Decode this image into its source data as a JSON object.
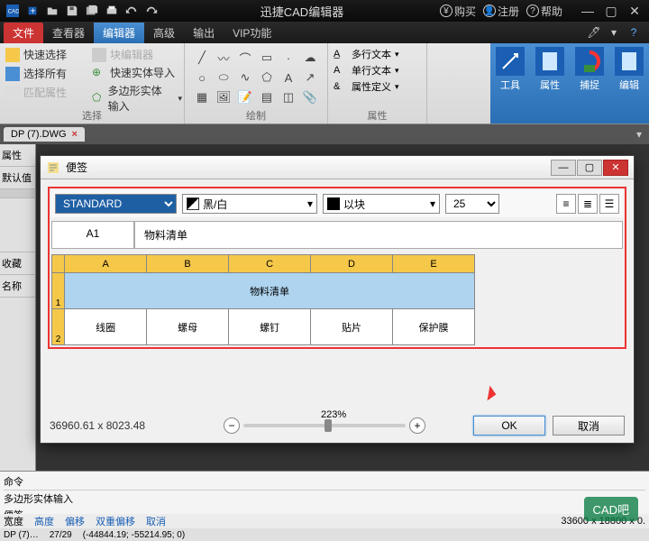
{
  "titlebar": {
    "title": "迅捷CAD编辑器",
    "buy": "购买",
    "register": "注册",
    "help": "帮助"
  },
  "menu": {
    "file": "文件",
    "viewer": "查看器",
    "editor": "编辑器",
    "advanced": "高级",
    "output": "输出",
    "vip": "VIP功能"
  },
  "ribbon": {
    "quick_select": "快速选择",
    "block_editor": "块编辑器",
    "select_all": "选择所有",
    "quick_entity_import": "快速实体导入",
    "match_props": "匹配属性",
    "poly_entity_input": "多边形实体输入",
    "group_select": "选择",
    "group_draw": "绘制",
    "multiline_text": "多行文本",
    "singleline_text": "单行文本",
    "attr_def": "属性定义",
    "group_attr": "属性",
    "tools": "工具",
    "properties": "属性",
    "capture": "捕捉",
    "edit": "编辑"
  },
  "doc_tab": "DP (7).DWG",
  "left_tabs": {
    "props": "属性",
    "defaults": "默认值",
    "favorites": "收藏",
    "name": "名称"
  },
  "dialog": {
    "title": "便签",
    "style": "STANDARD",
    "color_option": "黑/白",
    "layer_option": "以块",
    "size": "25",
    "cell_ref": "A1",
    "cell_formula": "物料清单",
    "cols": [
      "A",
      "B",
      "C",
      "D",
      "E"
    ],
    "rows": [
      {
        "num": "1",
        "merged": true,
        "value": "物料清单"
      },
      {
        "num": "2",
        "cells": [
          "线圈",
          "螺母",
          "螺钉",
          "贴片",
          "保护膜"
        ]
      }
    ],
    "coords": "36960.61 x 8023.48",
    "zoom": "223%",
    "ok": "OK",
    "cancel": "取消"
  },
  "cmd": {
    "label": "命令",
    "line1": "多边形实体输入",
    "line2": "便签"
  },
  "status1": {
    "width": "宽度",
    "height": "高度",
    "offset": "偏移",
    "double_offset": "双重偏移",
    "cancel": "取消",
    "right": "33600 x 18800 x 0."
  },
  "status2": {
    "tab": "DP (7)…",
    "pages": "27/29",
    "coords": "(-44844.19; -55214.95; 0)"
  },
  "watermark": "CAD吧"
}
